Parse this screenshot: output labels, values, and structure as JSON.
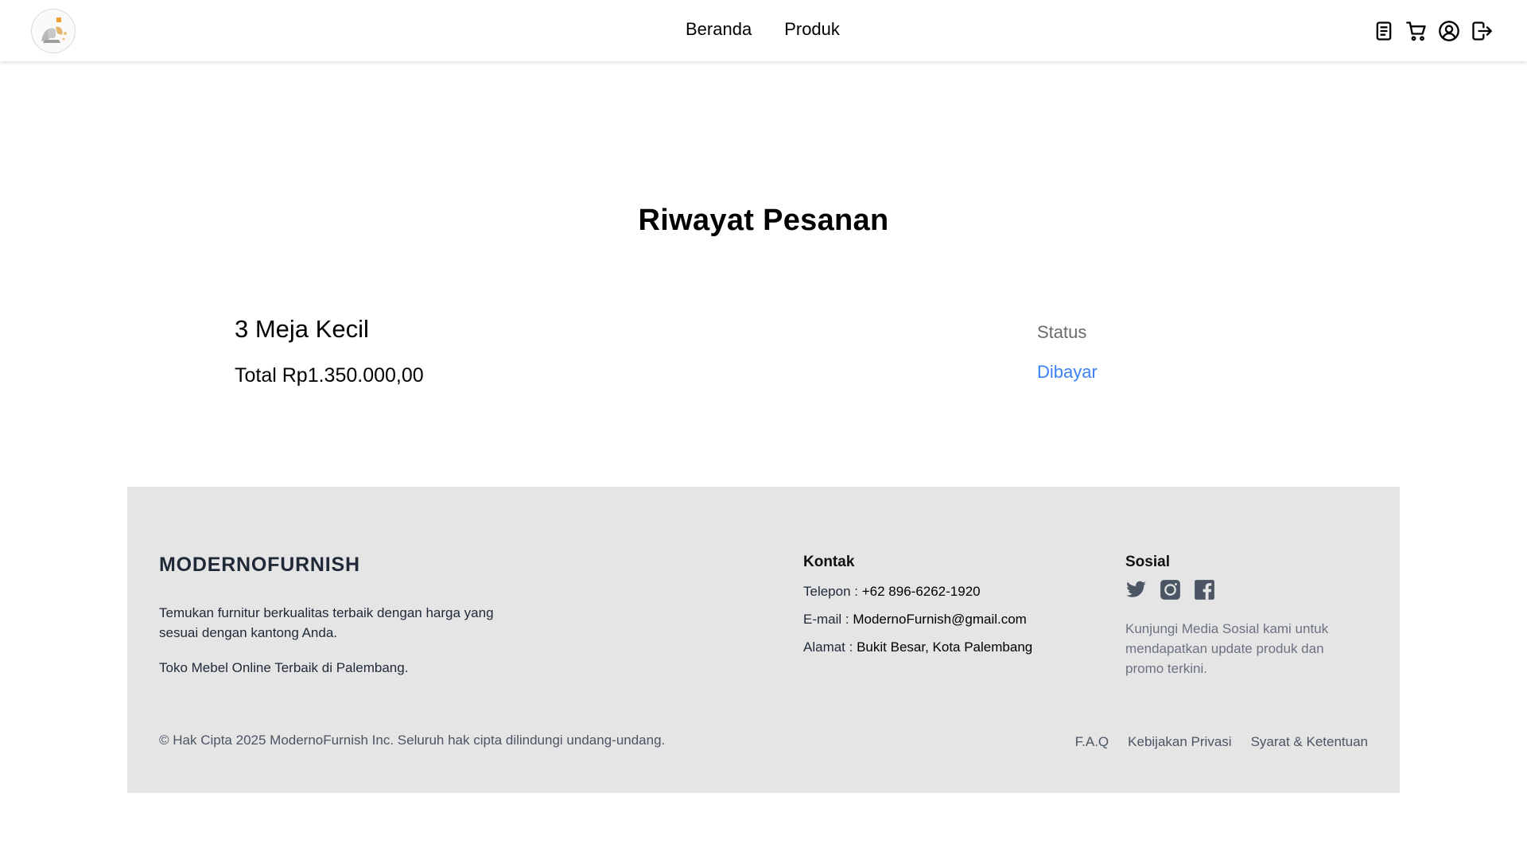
{
  "header": {
    "nav": [
      "Beranda",
      "Produk"
    ],
    "icons": [
      "orders-icon",
      "cart-icon",
      "profile-icon",
      "logout-icon"
    ]
  },
  "page": {
    "title": "Riwayat Pesanan"
  },
  "order": {
    "name": "3 Meja Kecil",
    "total": "Total Rp1.350.000,00",
    "status_label": "Status",
    "status_value": "Dibayar"
  },
  "footer": {
    "brand": "MODERNOFURNISH",
    "description": "Temukan furnitur berkualitas terbaik dengan harga yang sesuai dengan kantong Anda.",
    "tagline": "Toko Mebel Online Terbaik di Palembang.",
    "contact_title": "Kontak",
    "contact": [
      {
        "label": "Telepon : ",
        "value": "+62 896-6262-1920"
      },
      {
        "label": "E-mail : ",
        "value": "ModernoFurnish@gmail.com"
      },
      {
        "label": "Alamat : ",
        "value": "Bukit Besar, Kota Palembang"
      }
    ],
    "social_title": "Sosial",
    "social_icons": [
      "twitter-icon",
      "instagram-icon",
      "facebook-icon"
    ],
    "social_desc": "Kunjungi Media Sosial kami untuk mendapatkan update produk dan promo terkini.",
    "copyright": "© Hak Cipta 2025 ModernoFurnish Inc. Seluruh hak cipta dilindungi undang-undang.",
    "links": [
      "F.A.Q",
      "Kebijakan Privasi",
      "Syarat & Ketentuan"
    ]
  },
  "colors": {
    "accent": "#3b82f6",
    "footer_bg": "#e5e5e5"
  }
}
